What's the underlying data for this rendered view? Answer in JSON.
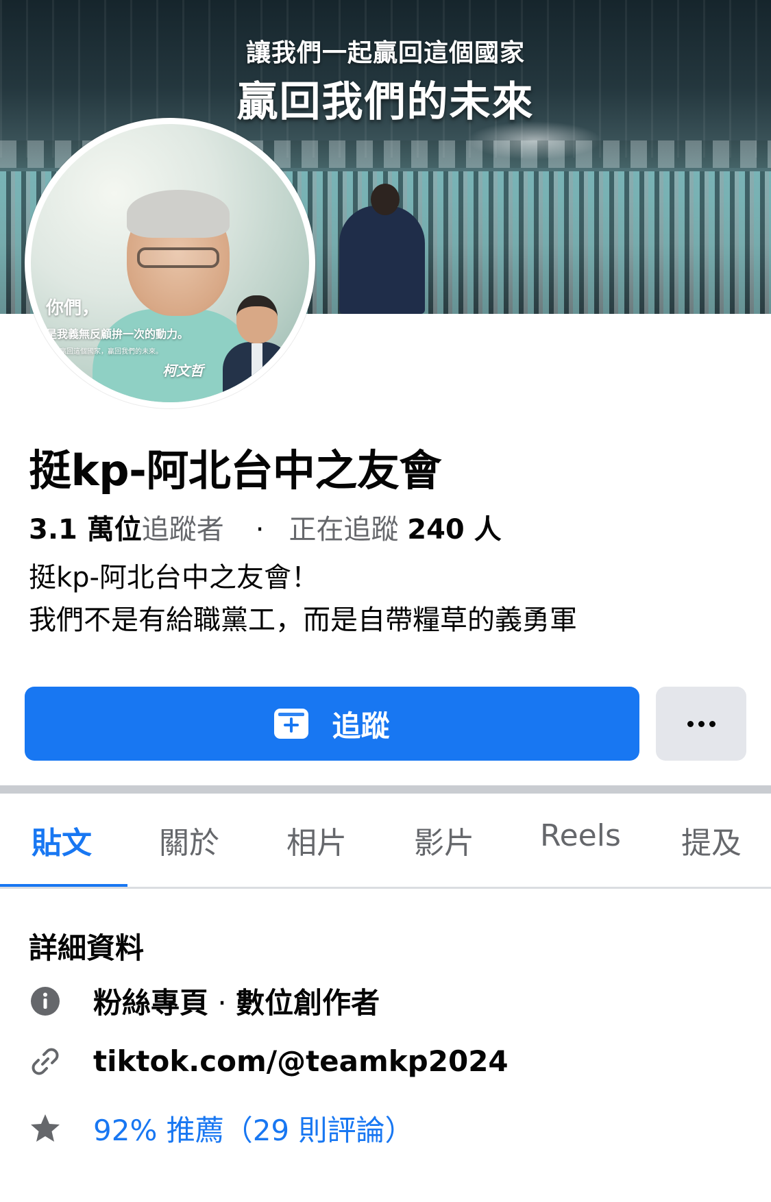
{
  "cover": {
    "slogan_line1": "讓我們一起贏回這個國家",
    "slogan_line2": "贏回我們的未來"
  },
  "avatar": {
    "caption_line1": "你們，",
    "caption_line2": "是我義無反顧拚一次的動力。",
    "caption_line3": "一起贏回這個國家，贏回我們的未來。",
    "signature": "柯文哲"
  },
  "page": {
    "name": "挺kp-阿北台中之友會",
    "followers_count": "3.1 萬位",
    "followers_label": "追蹤者",
    "separator": "·",
    "following_label": "正在追蹤",
    "following_count": "240 人",
    "bio_line1": "挺kp-阿北台中之友會！",
    "bio_line2": "我們不是有給職黨工，而是自帶糧草的義勇軍"
  },
  "actions": {
    "follow_label": "追蹤",
    "follow_icon": "follow-plus-icon",
    "more_icon": "more-dots-icon"
  },
  "tabs": [
    {
      "label": "貼文",
      "active": true
    },
    {
      "label": "關於",
      "active": false
    },
    {
      "label": "相片",
      "active": false
    },
    {
      "label": "影片",
      "active": false
    },
    {
      "label": "Reels",
      "active": false
    },
    {
      "label": "提及",
      "active": false
    }
  ],
  "details": {
    "title": "詳細資料",
    "category_main": "粉絲專頁",
    "category_sep": " · ",
    "category_sub": "數位創作者",
    "link": "tiktok.com/@teamkp2024",
    "rating": "92% 推薦（29 則評論）"
  },
  "colors": {
    "accent": "#1877f2",
    "secondary_button": "#e4e6eb",
    "muted_text": "#65676b"
  }
}
